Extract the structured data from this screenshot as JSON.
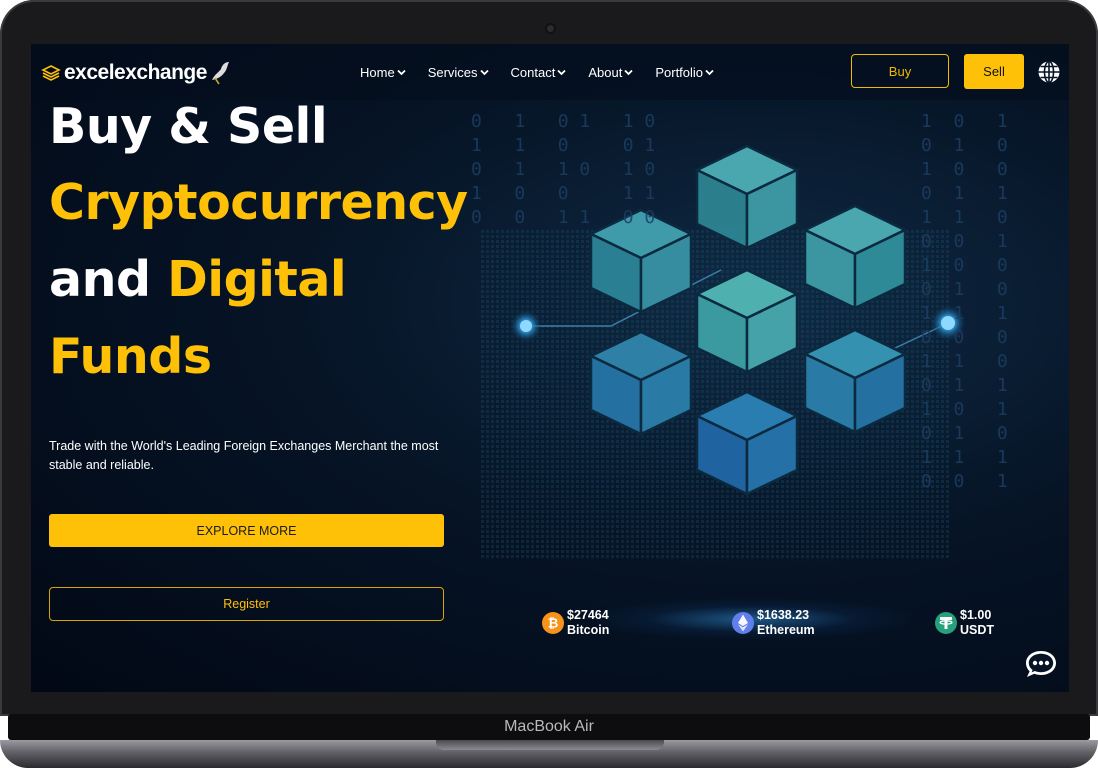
{
  "device": {
    "label": "MacBook Air"
  },
  "brand": {
    "name": "excelexchange"
  },
  "nav": {
    "items": [
      {
        "label": "Home"
      },
      {
        "label": "Services"
      },
      {
        "label": "Contact"
      },
      {
        "label": "About"
      },
      {
        "label": "Portfolio"
      }
    ],
    "buy_label": "Buy",
    "sell_label": "Sell"
  },
  "hero": {
    "line1": "Buy & Sell",
    "line2": "Cryptocurrency",
    "line3_a": "and",
    "line3_b": "Digital",
    "line4": "Funds",
    "subtitle": "Trade with the World's Leading Foreign Exchanges Merchant the most stable and reliable.",
    "explore_label": "EXPLORE MORE",
    "register_label": "Register"
  },
  "tickers": [
    {
      "price": "$27464",
      "name": "Bitcoin",
      "icon": "bitcoin-icon"
    },
    {
      "price": "$1638.23",
      "name": "Ethereum",
      "icon": "ethereum-icon"
    },
    {
      "price": "$1.00",
      "name": "USDT",
      "icon": "tether-icon"
    }
  ],
  "colors": {
    "accent": "#ffc107",
    "background": "#061426",
    "text": "#ffffff"
  }
}
